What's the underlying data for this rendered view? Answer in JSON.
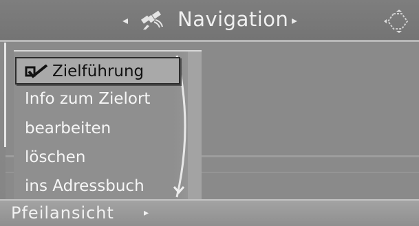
{
  "header": {
    "title": "Navigation",
    "left_arrow": "◂",
    "right_arrow": "▸",
    "icons": [
      "satellite-icon",
      "controller-icon"
    ]
  },
  "menu": {
    "items": [
      {
        "label": "Zielführung",
        "selected": true,
        "checked": true,
        "icon": "checkmark-icon"
      },
      {
        "label": "Info zum Zielort"
      },
      {
        "label": "bearbeiten"
      },
      {
        "label": "löschen"
      },
      {
        "label": "ins Adressbuch"
      }
    ],
    "scroll_indicator": "scroll-down-icon"
  },
  "footer": {
    "label": "Pfeilansicht",
    "arrow": "▸"
  },
  "colors": {
    "background": "#8a8a8a",
    "header": "#7a7a7a",
    "selection": "#a9a9a9",
    "text": "#f4f4f4",
    "selected_text": "#111111"
  }
}
